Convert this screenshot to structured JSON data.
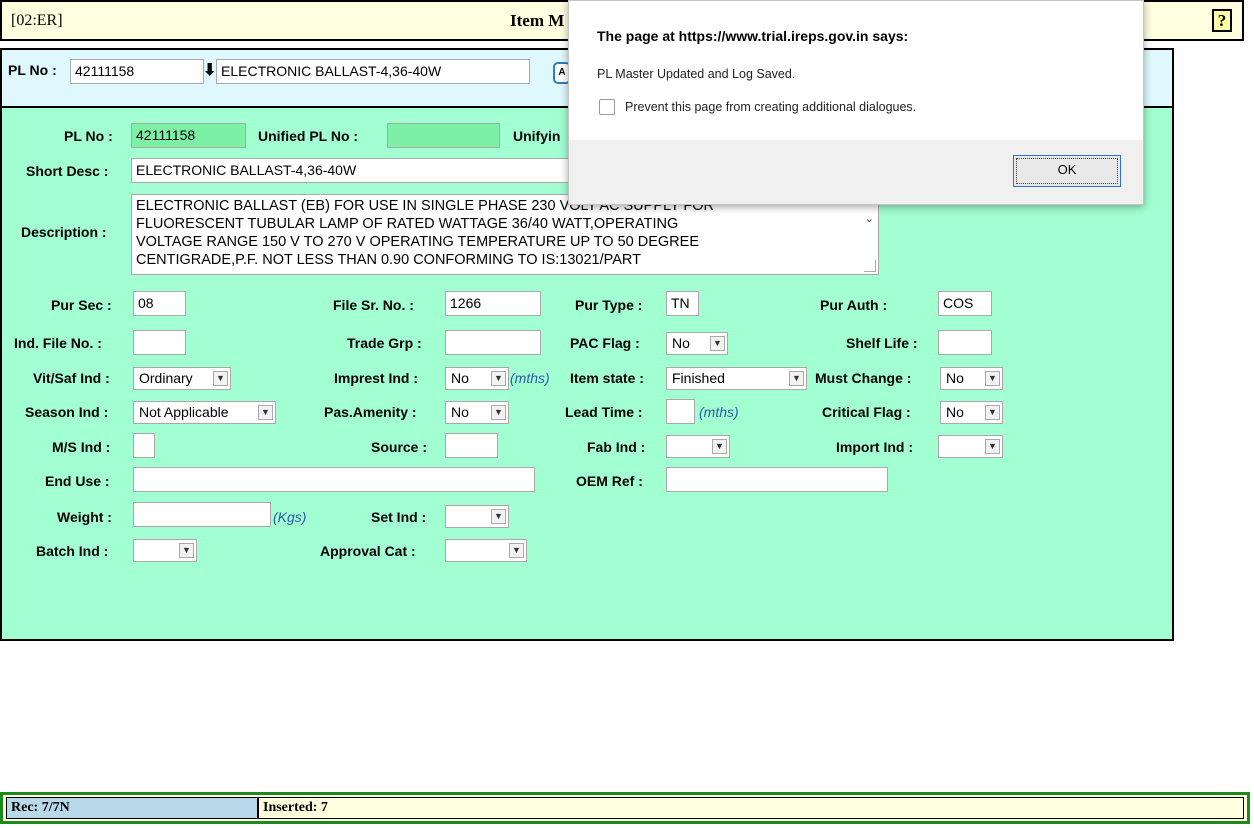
{
  "header": {
    "window_code": "[02:ER]",
    "title": "Item M",
    "help_label": "?"
  },
  "search": {
    "pl_label": "PL No :",
    "pl_value": "42111158",
    "desc_value": "ELECTRONIC BALLAST-4,36-40W"
  },
  "form": {
    "pl_no": {
      "label": "PL No :",
      "value": "42111158"
    },
    "unified_pl": {
      "label": "Unified PL No :",
      "value": ""
    },
    "unifying": {
      "label": "Unifyin"
    },
    "short_desc": {
      "label": "Short Desc :",
      "value": "ELECTRONIC BALLAST-4,36-40W"
    },
    "description": {
      "label": "Description :",
      "value": "ELECTRONIC BALLAST (EB) FOR USE IN SINGLE PHASE 230 VOLT AC SUPPLY FOR\nFLUORESCENT TUBULAR LAMP OF RATED WATTAGE 36/40 WATT,OPERATING\nVOLTAGE RANGE 150 V TO 270 V OPERATING TEMPERATURE UP TO 50 DEGREE\nCENTIGRADE,P.F. NOT LESS THAN 0.90 CONFORMING TO IS:13021/PART"
    },
    "pur_sec": {
      "label": "Pur Sec :",
      "value": "08"
    },
    "file_sr_no": {
      "label": "File Sr. No. :",
      "value": "1266"
    },
    "pur_type": {
      "label": "Pur Type :",
      "value": "TN"
    },
    "pur_auth": {
      "label": "Pur Auth :",
      "value": "COS"
    },
    "ind_file_no": {
      "label": "Ind. File No. :",
      "value": ""
    },
    "trade_grp": {
      "label": "Trade Grp :",
      "value": ""
    },
    "pac_flag": {
      "label": "PAC Flag :",
      "value": "No"
    },
    "shelf_life": {
      "label": "Shelf Life :",
      "value": ""
    },
    "vit_saf_ind": {
      "label": "Vit/Saf Ind :",
      "value": "Ordinary"
    },
    "imprest_ind": {
      "label": "Imprest Ind :",
      "value": "No",
      "unit": "(mths)"
    },
    "item_state": {
      "label": "Item state :",
      "value": "Finished"
    },
    "must_change": {
      "label": "Must Change :",
      "value": "No"
    },
    "season_ind": {
      "label": "Season Ind :",
      "value": "Not Applicable"
    },
    "pas_amenity": {
      "label": "Pas.Amenity :",
      "value": "No"
    },
    "lead_time": {
      "label": "Lead Time :",
      "value": "",
      "unit": "(mths)"
    },
    "critical_flag": {
      "label": "Critical Flag :",
      "value": "No"
    },
    "ms_ind": {
      "label": "M/S Ind :",
      "value": ""
    },
    "source": {
      "label": "Source :",
      "value": ""
    },
    "fab_ind": {
      "label": "Fab Ind :",
      "value": ""
    },
    "import_ind": {
      "label": "Import Ind :",
      "value": ""
    },
    "end_use": {
      "label": "End Use :",
      "value": ""
    },
    "oem_ref": {
      "label": "OEM Ref :",
      "value": ""
    },
    "weight": {
      "label": "Weight :",
      "value": "",
      "unit": "(Kgs)"
    },
    "set_ind": {
      "label": "Set Ind :",
      "value": ""
    },
    "batch_ind": {
      "label": "Batch Ind :",
      "value": ""
    },
    "approval_cat": {
      "label": "Approval Cat :",
      "value": ""
    }
  },
  "dialog": {
    "title": "The page at https://www.trial.ireps.gov.in says:",
    "message": "PL Master Updated and Log Saved.",
    "checkbox_label": "Prevent this page from creating additional dialogues.",
    "ok_label": "OK"
  },
  "status": {
    "rec": "Rec: 7/7N",
    "inserted": "Inserted: 7"
  }
}
